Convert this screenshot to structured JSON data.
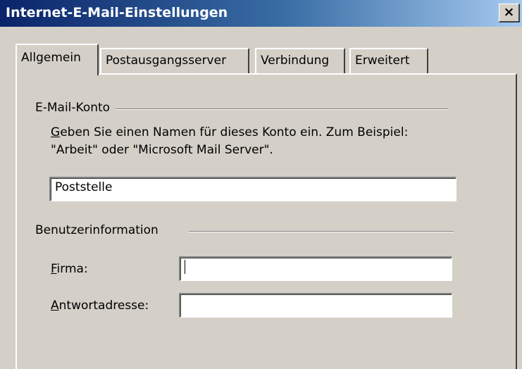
{
  "window": {
    "title": "Internet-E-Mail-Einstellungen",
    "close_glyph": "×"
  },
  "tabs": [
    {
      "label": "Allgemein",
      "active": true
    },
    {
      "label": "Postausgangsserver",
      "active": false
    },
    {
      "label": "Verbindung",
      "active": false
    },
    {
      "label": "Erweitert",
      "active": false
    }
  ],
  "account_group": {
    "label": "E-Mail-Konto",
    "desc_mnemonic": "G",
    "desc_line1_rest": "eben Sie einen Namen für dieses Konto ein. Zum Beispiel:",
    "desc_line2": "\"Arbeit\" oder \"Microsoft Mail Server\".",
    "account_name_value": "Poststelle"
  },
  "user_group": {
    "label": "Benutzerinformation",
    "company_mnemonic": "F",
    "company_label_rest": "irma:",
    "company_value": "",
    "reply_mnemonic": "A",
    "reply_label_rest": "ntwortadresse:",
    "reply_value": ""
  }
}
